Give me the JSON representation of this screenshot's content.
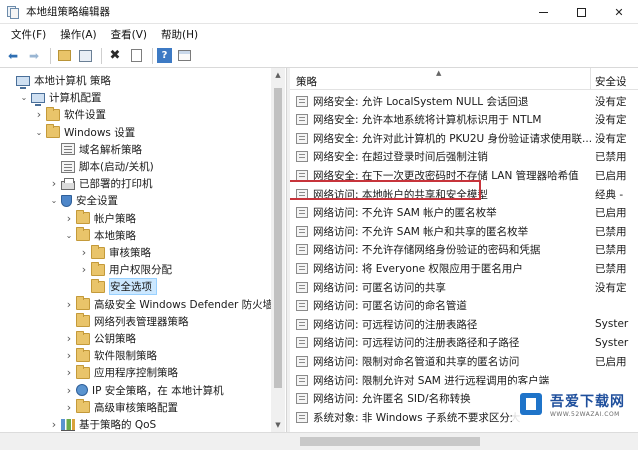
{
  "window": {
    "title": "本地组策略编辑器"
  },
  "menu": [
    "文件(F)",
    "操作(A)",
    "查看(V)",
    "帮助(H)"
  ],
  "tree": [
    {
      "label": "本地计算机 策略",
      "icon": "computer-icon",
      "expander": "",
      "depth": 0
    },
    {
      "label": "计算机配置",
      "icon": "computer-icon",
      "expander": "expanded",
      "depth": 1
    },
    {
      "label": "软件设置",
      "icon": "folder-icon",
      "expander": "collapsed",
      "depth": 2
    },
    {
      "label": "Windows 设置",
      "icon": "folder-icon",
      "expander": "expanded",
      "depth": 2
    },
    {
      "label": "域名解析策略",
      "icon": "list-icon",
      "expander": "",
      "depth": 3
    },
    {
      "label": "脚本(启动/关机)",
      "icon": "list-icon",
      "expander": "",
      "depth": 3
    },
    {
      "label": "已部署的打印机",
      "icon": "printer-icon",
      "expander": "collapsed",
      "depth": 3
    },
    {
      "label": "安全设置",
      "icon": "shield-icon",
      "expander": "expanded",
      "depth": 3
    },
    {
      "label": "帐户策略",
      "icon": "folder-icon",
      "expander": "collapsed",
      "depth": 4
    },
    {
      "label": "本地策略",
      "icon": "folder-icon",
      "expander": "expanded",
      "depth": 4
    },
    {
      "label": "审核策略",
      "icon": "folder-icon",
      "expander": "collapsed",
      "depth": 5
    },
    {
      "label": "用户权限分配",
      "icon": "folder-icon",
      "expander": "collapsed",
      "depth": 5
    },
    {
      "label": "安全选项",
      "icon": "folder-icon",
      "expander": "",
      "depth": 5,
      "selected": true
    },
    {
      "label": "高级安全 Windows Defender 防火墙",
      "icon": "folder-icon",
      "expander": "collapsed",
      "depth": 4
    },
    {
      "label": "网络列表管理器策略",
      "icon": "folder-icon",
      "expander": "",
      "depth": 4
    },
    {
      "label": "公钥策略",
      "icon": "folder-icon",
      "expander": "collapsed",
      "depth": 4
    },
    {
      "label": "软件限制策略",
      "icon": "folder-icon",
      "expander": "collapsed",
      "depth": 4
    },
    {
      "label": "应用程序控制策略",
      "icon": "folder-icon",
      "expander": "collapsed",
      "depth": 4
    },
    {
      "label": "IP 安全策略，在 本地计算机",
      "icon": "net-icon",
      "expander": "collapsed",
      "depth": 4
    },
    {
      "label": "高级审核策略配置",
      "icon": "folder-icon",
      "expander": "collapsed",
      "depth": 4
    },
    {
      "label": "基于策略的 QoS",
      "icon": "stats-icon",
      "expander": "collapsed",
      "depth": 3
    }
  ],
  "columns": {
    "policy": "策略",
    "setting": "安全设"
  },
  "policies": [
    {
      "name": "网络安全: 允许 LocalSystem NULL 会话回退",
      "setting": "没有定"
    },
    {
      "name": "网络安全: 允许本地系统将计算机标识用于 NTLM",
      "setting": "没有定"
    },
    {
      "name": "网络安全: 允许对此计算机的 PKU2U 身份验证请求使用联...",
      "setting": "没有定"
    },
    {
      "name": "网络安全: 在超过登录时间后强制注销",
      "setting": "已禁用"
    },
    {
      "name": "网络安全: 在下一次更改密码时不存储 LAN 管理器哈希值",
      "setting": "已启用"
    },
    {
      "name": "网络访问: 本地帐户的共享和安全模型",
      "setting": "经典 -",
      "highlighted": true
    },
    {
      "name": "网络访问: 不允许 SAM 帐户的匿名枚举",
      "setting": "已启用"
    },
    {
      "name": "网络访问: 不允许 SAM 帐户和共享的匿名枚举",
      "setting": "已禁用"
    },
    {
      "name": "网络访问: 不允许存储网络身份验证的密码和凭据",
      "setting": "已禁用"
    },
    {
      "name": "网络访问: 将 Everyone 权限应用于匿名用户",
      "setting": "已禁用"
    },
    {
      "name": "网络访问: 可匿名访问的共享",
      "setting": "没有定"
    },
    {
      "name": "网络访问: 可匿名访问的命名管道",
      "setting": ""
    },
    {
      "name": "网络访问: 可远程访问的注册表路径",
      "setting": "Syster"
    },
    {
      "name": "网络访问: 可远程访问的注册表路径和子路径",
      "setting": "Syster"
    },
    {
      "name": "网络访问: 限制对命名管道和共享的匿名访问",
      "setting": "已启用"
    },
    {
      "name": "网络访问: 限制允许对 SAM 进行远程调用的客户端",
      "setting": ""
    },
    {
      "name": "网络访问: 允许匿名 SID/名称转换",
      "setting": ""
    },
    {
      "name": "系统对象: 非 Windows 子系统不要求区分大",
      "setting": ""
    }
  ],
  "watermark": {
    "main": "吾爱下载网",
    "sub": "WWW.52WAZAI.COM"
  }
}
